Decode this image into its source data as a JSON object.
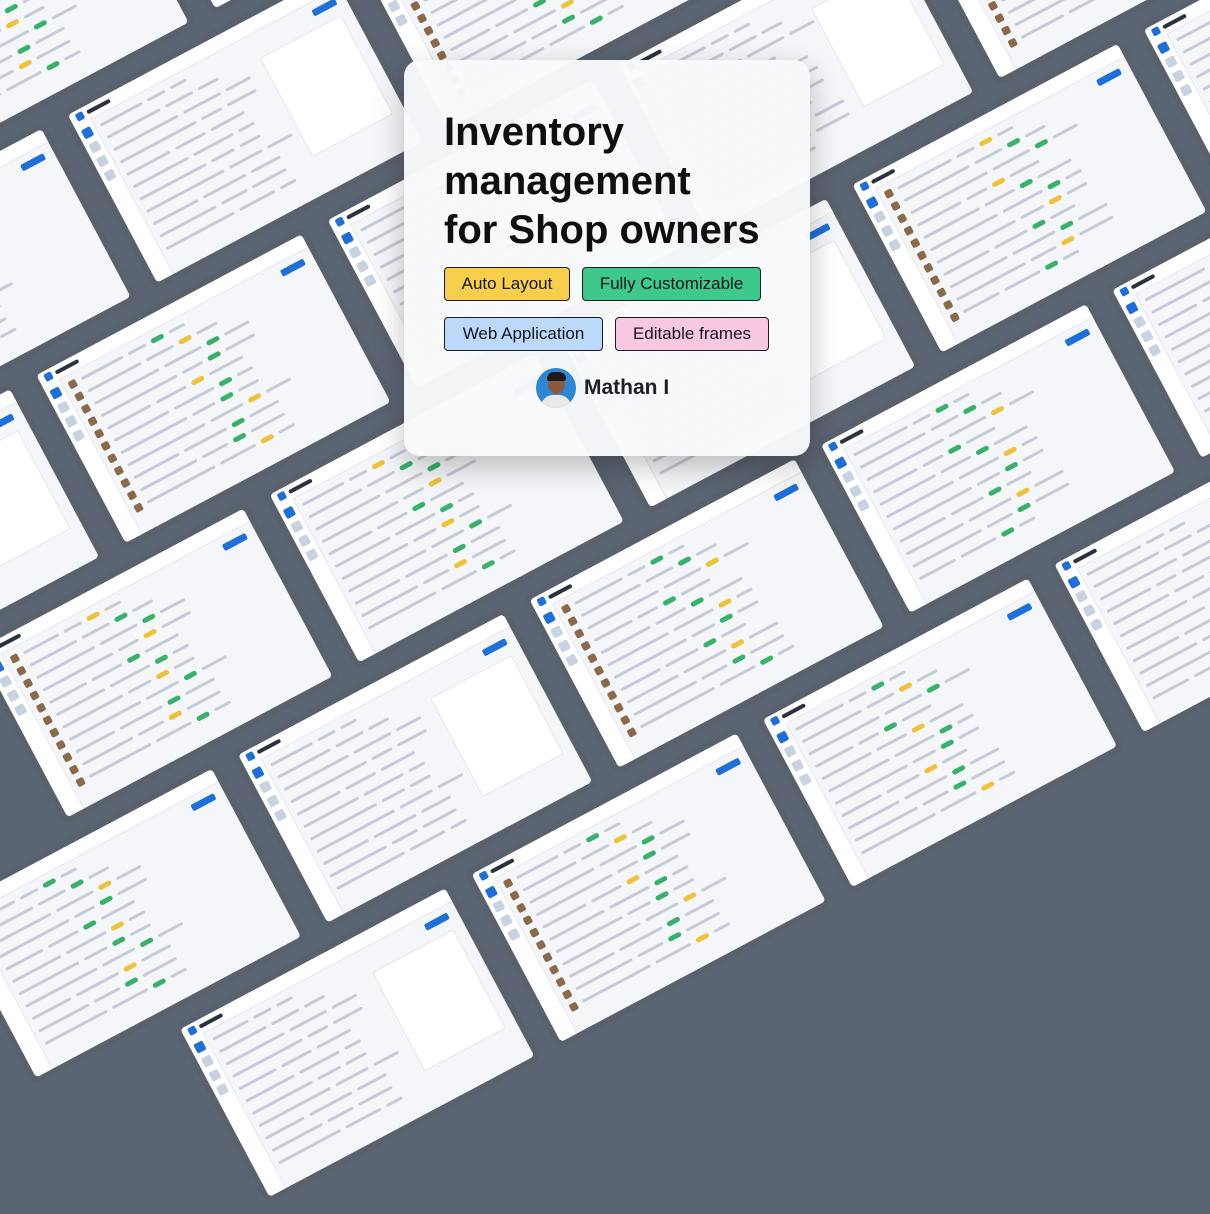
{
  "hero": {
    "title": "Inventory\nmanagement\nfor Shop owners",
    "tags": [
      {
        "label": "Auto Layout",
        "color": "#f7cf4a"
      },
      {
        "label": "Fully Customizable",
        "color": "#3cc98b"
      },
      {
        "label": "Web Application",
        "color": "#bcd8fb"
      },
      {
        "label": "Editable frames",
        "color": "#f8c7e0"
      }
    ],
    "author": "Mathan I"
  },
  "background": {
    "brand_color": "#1e6fd9",
    "frame_border": "#59616d"
  }
}
